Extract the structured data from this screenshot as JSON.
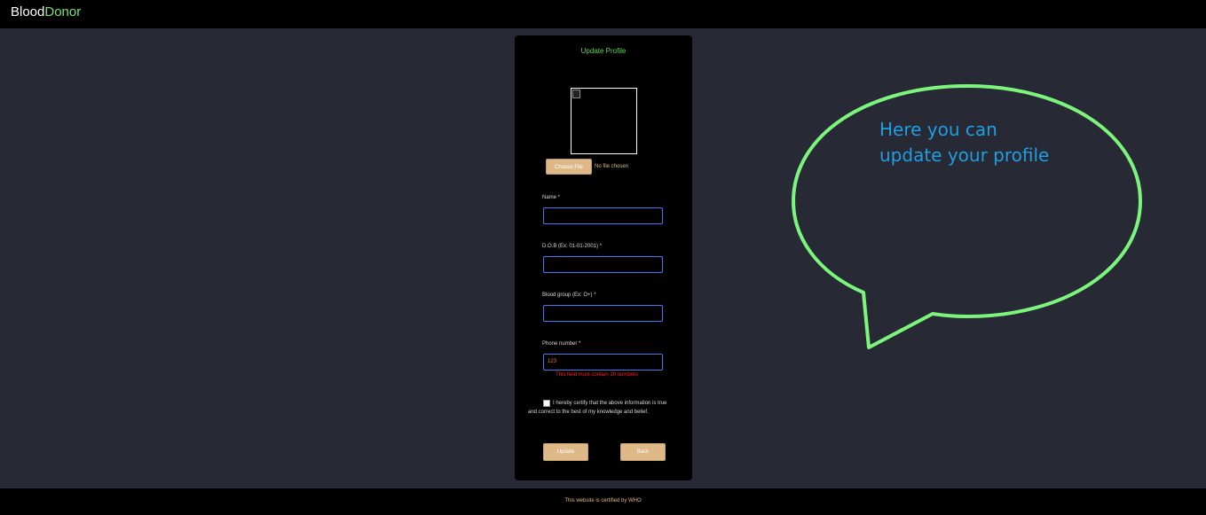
{
  "brand": {
    "part1": "Blood",
    "part2": "Donor"
  },
  "form": {
    "title": "Update Profile",
    "file_button": "Choose File",
    "file_status": "No file chosen",
    "fields": [
      {
        "label": "Name *",
        "value": ""
      },
      {
        "label": "D.O.B (Ex: 01-01-2001) *",
        "value": ""
      },
      {
        "label": "Blood group (Ex: O+) *",
        "value": ""
      },
      {
        "label": "Phone number *",
        "value": "123"
      }
    ],
    "phone_error": "This field must contain 10 numbers",
    "certify_text": "I hereby certify that the above information is true and correct to the best of my knowledge and belief.",
    "update_button": "Update",
    "back_button": "Back"
  },
  "callout": {
    "line1": "Here you can",
    "line2": "update your profile"
  },
  "footer": {
    "text": "This website is certified by WHO"
  },
  "colors": {
    "background": "#272935",
    "accent_green": "#79e07a",
    "button": "#deb887",
    "input_border": "#3e7cf0",
    "error": "#ff2020",
    "callout_text": "#1f9ee0"
  }
}
